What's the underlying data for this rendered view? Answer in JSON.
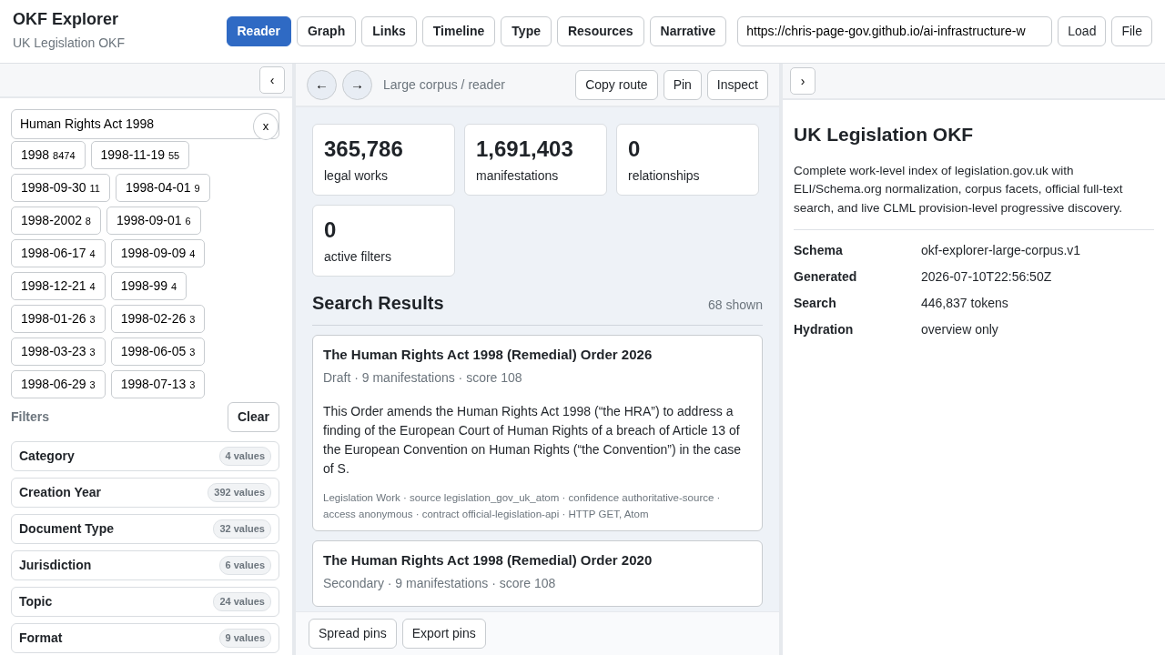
{
  "app": {
    "title": "OKF Explorer",
    "subtitle": "UK Legislation OKF"
  },
  "tabs": [
    {
      "label": "Reader",
      "selected": true
    },
    {
      "label": "Graph",
      "selected": false
    },
    {
      "label": "Links",
      "selected": false
    },
    {
      "label": "Timeline",
      "selected": false
    },
    {
      "label": "Type",
      "selected": false
    },
    {
      "label": "Resources",
      "selected": false
    },
    {
      "label": "Narrative",
      "selected": false
    }
  ],
  "url_field": {
    "value": "https://chris-page-gov.github.io/ai-infrastructure-w"
  },
  "header_buttons": [
    "Load",
    "File"
  ],
  "left_panel": {
    "collapse_button": "‹",
    "search": {
      "value": "Human Rights Act 1998",
      "clear_button": "x"
    },
    "chips": [
      {
        "label": "1998",
        "count": "8474"
      },
      {
        "label": "1998-11-19",
        "count": "55"
      },
      {
        "label": "1998-09-30",
        "count": "11"
      },
      {
        "label": "1998-04-01",
        "count": "9"
      },
      {
        "label": "1998-2002",
        "count": "8"
      },
      {
        "label": "1998-09-01",
        "count": "6"
      },
      {
        "label": "1998-06-17",
        "count": "4"
      },
      {
        "label": "1998-09-09",
        "count": "4"
      },
      {
        "label": "1998-12-21",
        "count": "4"
      },
      {
        "label": "1998-99",
        "count": "4"
      },
      {
        "label": "1998-01-26",
        "count": "3"
      },
      {
        "label": "1998-02-26",
        "count": "3"
      },
      {
        "label": "1998-03-23",
        "count": "3"
      },
      {
        "label": "1998-06-05",
        "count": "3"
      },
      {
        "label": "1998-06-29",
        "count": "3"
      },
      {
        "label": "1998-07-13",
        "count": "3"
      }
    ],
    "filters_heading": "Filters",
    "clear_button": "Clear",
    "facets": [
      {
        "name": "Category",
        "count": "4 values"
      },
      {
        "name": "Creation Year",
        "count": "392 values"
      },
      {
        "name": "Document Type",
        "count": "32 values"
      },
      {
        "name": "Jurisdiction",
        "count": "6 values"
      },
      {
        "name": "Topic",
        "count": "24 values"
      },
      {
        "name": "Format",
        "count": "9 values"
      }
    ]
  },
  "reader": {
    "back_button": "←",
    "forward_button": "→",
    "breadcrumb": "Large corpus / reader",
    "actions": [
      "Copy route",
      "Pin",
      "Inspect"
    ],
    "stats": [
      {
        "value": "365,786",
        "label": "legal works"
      },
      {
        "value": "1,691,403",
        "label": "manifestations"
      },
      {
        "value": "0",
        "label": "relationships"
      },
      {
        "value": "0",
        "label": "active filters"
      }
    ],
    "results_heading": "Search Results",
    "results_count": "68 shown",
    "results": [
      {
        "title": "The Human Rights Act 1998 (Remedial) Order 2026",
        "meta": "Draft · 9 manifestations · score 108",
        "summary": "This Order amends the Human Rights Act 1998 (“the HRA”) to address a finding of the European Court of Human Rights of a breach of Article 13 of the European Convention on Human Rights (“the Convention”) in the case of S.",
        "provenance": "Legislation Work · source legislation_gov_uk_atom · confidence authoritative-source · access anonymous · contract official-legislation-api · HTTP GET, Atom"
      },
      {
        "title": "The Human Rights Act 1998 (Remedial) Order 2020",
        "meta": "Secondary · 9 manifestations · score 108"
      }
    ],
    "footer_buttons": [
      "Spread pins",
      "Export pins"
    ]
  },
  "details": {
    "expand_button": "›",
    "title": "UK Legislation OKF",
    "description": "Complete work-level index of legislation.gov.uk with ELI/Schema.org normalization, corpus facets, official full-text search, and live CLML provision-level progressive discovery.",
    "properties": [
      {
        "label": "Schema",
        "value": "okf-explorer-large-corpus.v1"
      },
      {
        "label": "Generated",
        "value": "2026-07-10T22:56:50Z"
      },
      {
        "label": "Search",
        "value": "446,837 tokens"
      },
      {
        "label": "Hydration",
        "value": "overview only"
      }
    ]
  }
}
